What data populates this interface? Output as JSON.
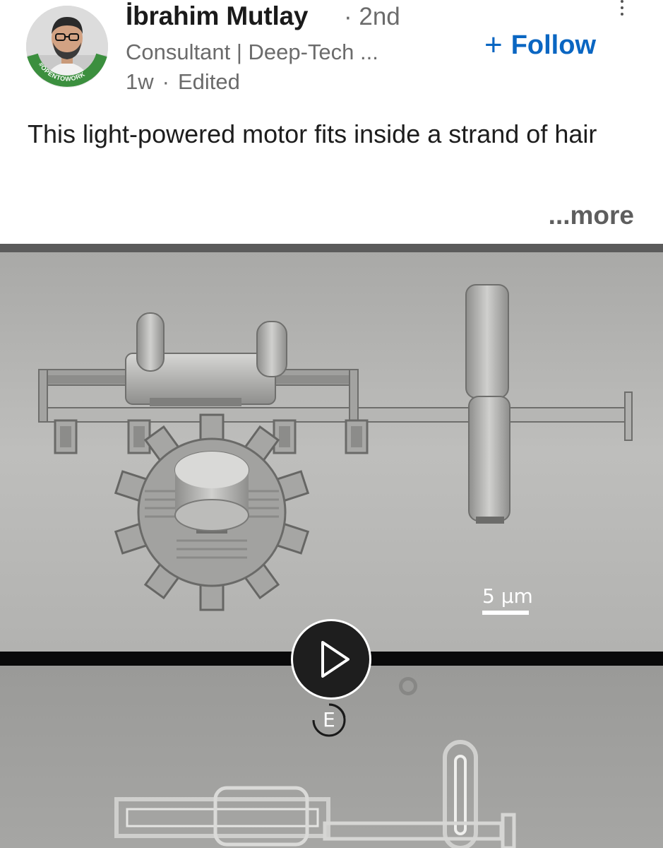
{
  "author": {
    "name": "İbrahim Mutlay",
    "degree": "· 2nd",
    "headline": "Consultant | Deep-Tech ...",
    "time": "1w",
    "dot": "·",
    "edited": "Edited",
    "badge_text": "#OPENTOWORK",
    "badge_color": "#2e7d32"
  },
  "actions": {
    "follow_plus": "+",
    "follow_label": "Follow",
    "menu_icon": "vertical-ellipsis-icon"
  },
  "post": {
    "text": "This light-powered motor fits inside a strand of hair",
    "see_more": "...more"
  },
  "media": {
    "scale_label": "5 µm",
    "play_icon": "play-icon",
    "badge_letter": "E"
  },
  "colors": {
    "accent": "#0a66c2",
    "secondary_text": "#6b6b6b",
    "primary_text": "#1d1d1d"
  }
}
